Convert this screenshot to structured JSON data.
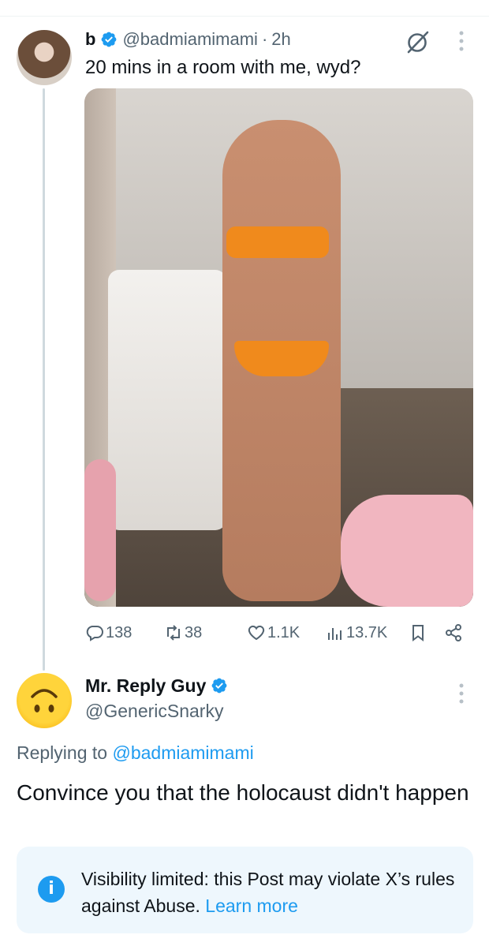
{
  "colors": {
    "accent": "#1d9bf0",
    "muted": "#536471",
    "text": "#0f1419",
    "notice_bg": "#eef7fd"
  },
  "post": {
    "display_name": "b",
    "handle": "@badmiamimami",
    "separator": "·",
    "time": "2h",
    "text": "20 mins in a room with me, wyd?",
    "verified_icon": "verified-badge-icon",
    "stats": {
      "replies": "138",
      "reposts": "38",
      "likes": "1.1K",
      "views": "13.7K"
    }
  },
  "reply": {
    "display_name": "Mr. Reply Guy",
    "handle": "@GenericSnarky",
    "replying_prefix": "Replying to",
    "replying_to": "@badmiamimami",
    "text": "Convince you that the holocaust didn't happen",
    "notice_text": "Visibility limited: this Post may violate X’s rules against Abuse.",
    "notice_link": "Learn more",
    "info_glyph": "i"
  }
}
